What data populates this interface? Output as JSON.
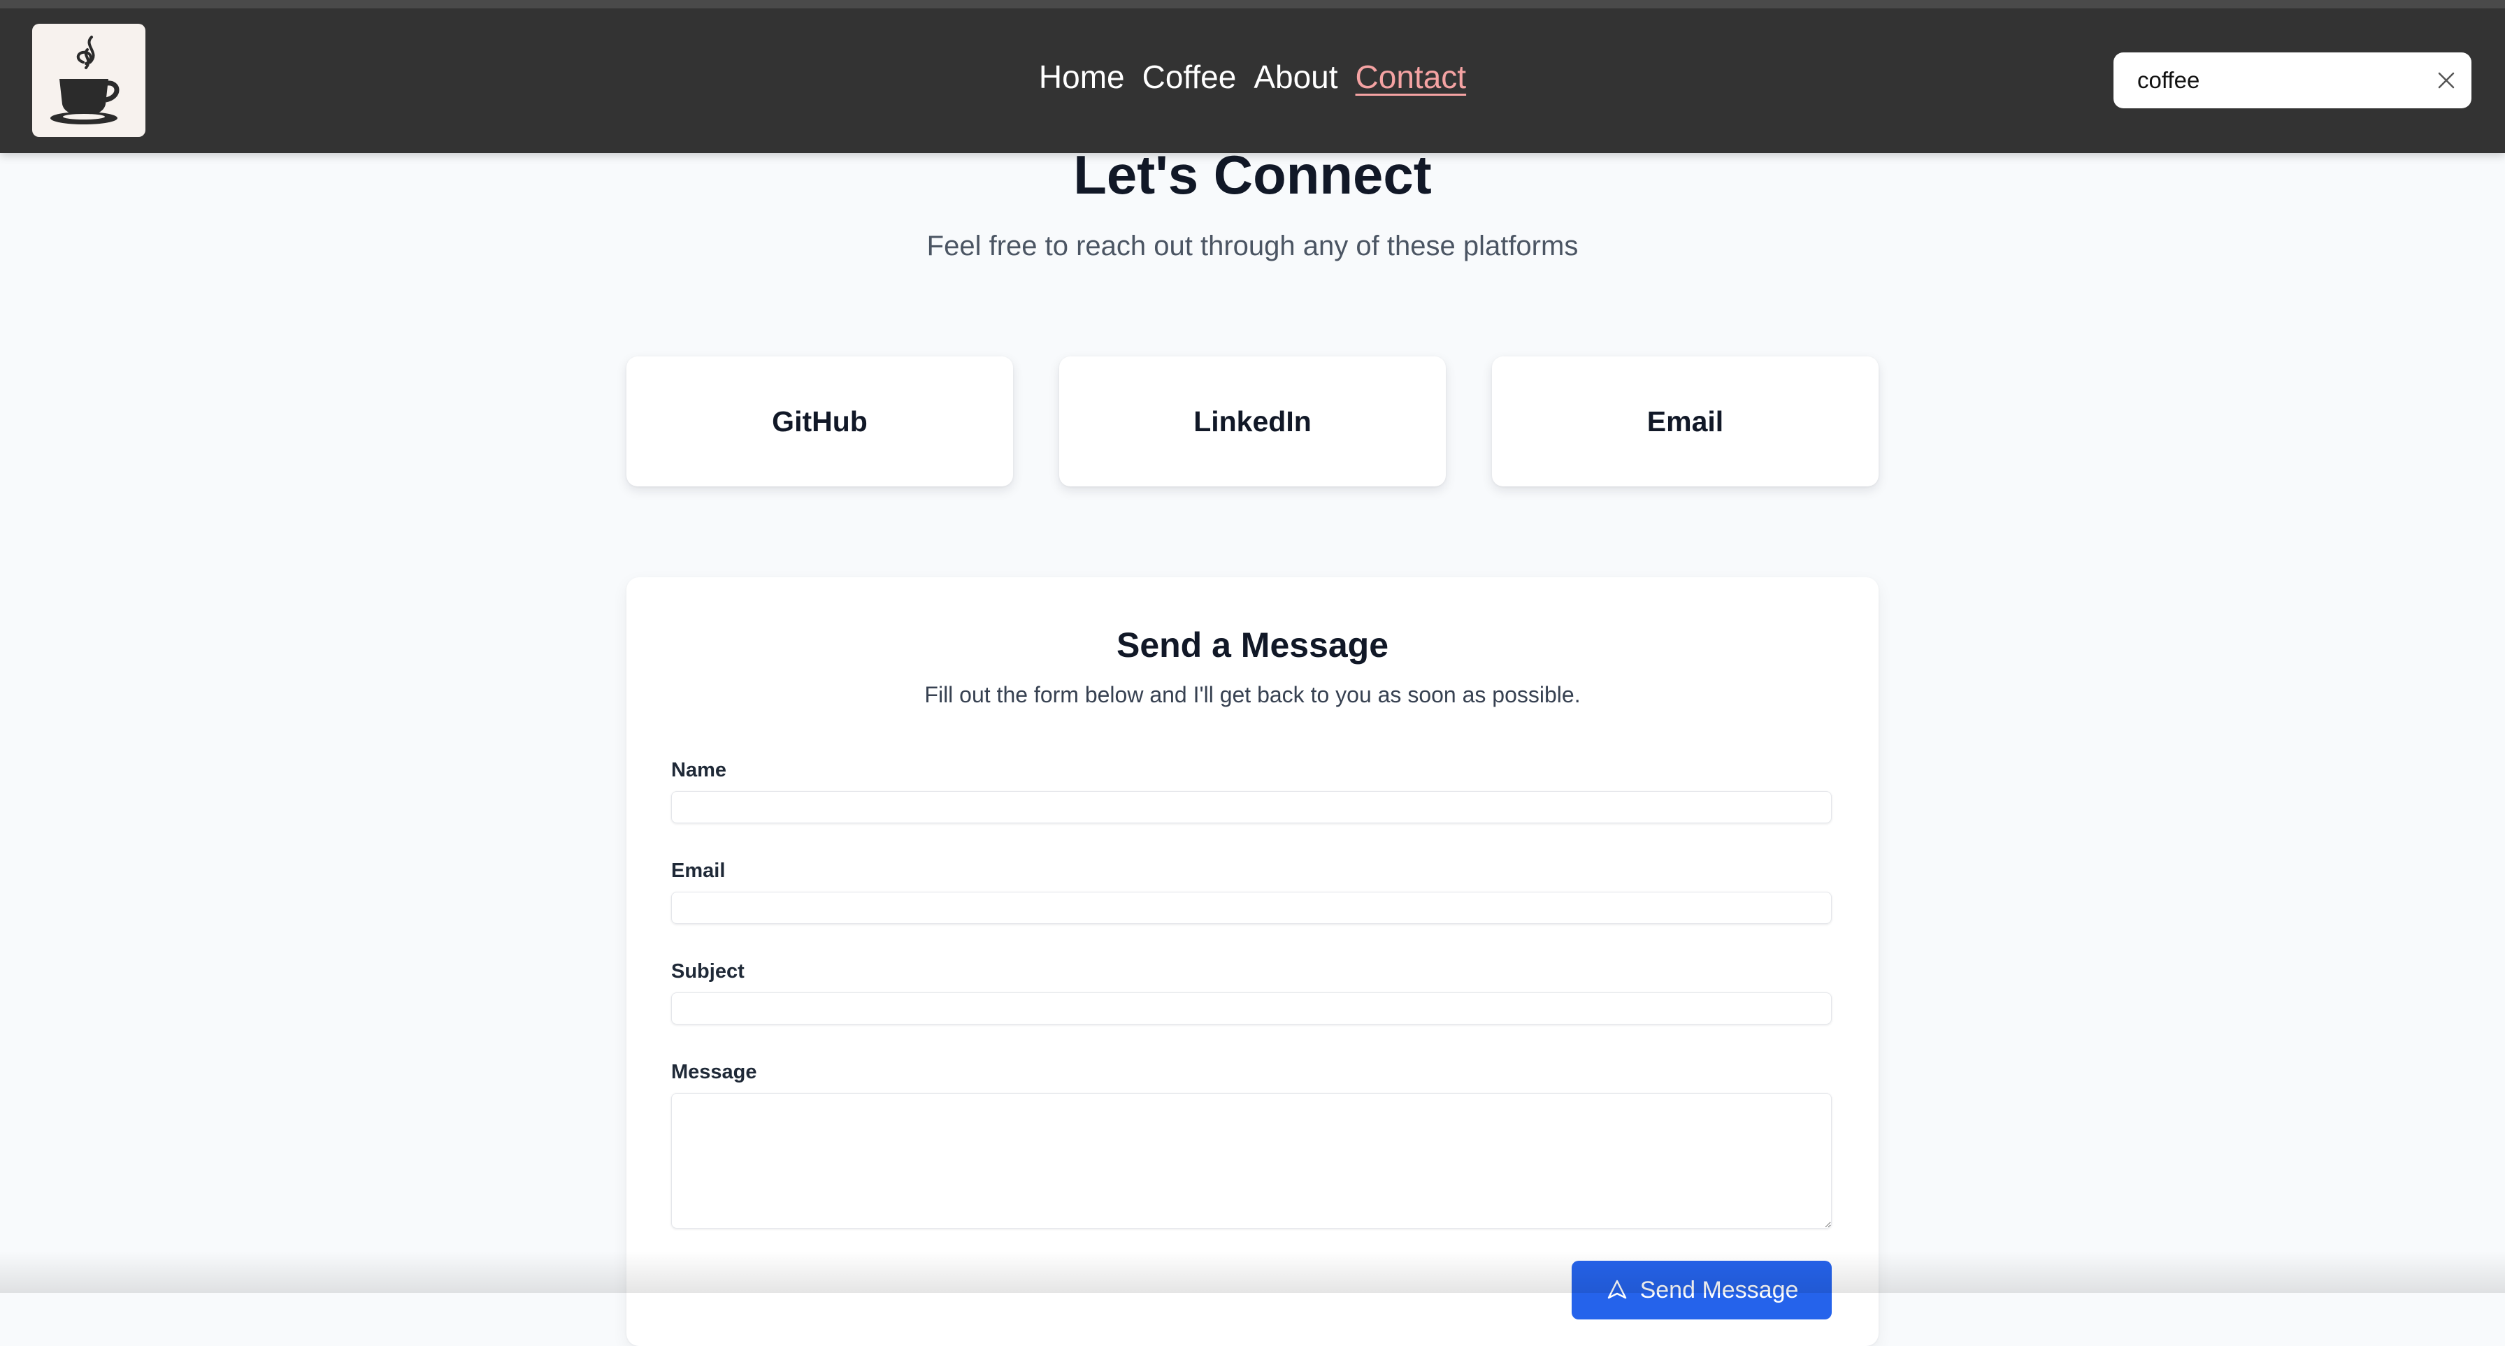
{
  "nav": {
    "links": [
      {
        "label": "Home"
      },
      {
        "label": "Coffee"
      },
      {
        "label": "About"
      },
      {
        "label": "Contact",
        "active": true
      }
    ],
    "active_color": "#f5a3a3",
    "background": "#333333"
  },
  "search": {
    "value": "coffee",
    "clear_icon": "close-icon"
  },
  "logo": {
    "icon": "coffee-cup-icon"
  },
  "hero": {
    "title": "Let's Connect",
    "subtitle": "Feel free to reach out through any of these platforms"
  },
  "platforms": [
    {
      "label": "GitHub"
    },
    {
      "label": "LinkedIn"
    },
    {
      "label": "Email"
    }
  ],
  "form": {
    "title": "Send a Message",
    "description": "Fill out the form below and I'll get back to you as soon as possible.",
    "fields": {
      "name": {
        "label": "Name",
        "value": ""
      },
      "email": {
        "label": "Email",
        "value": ""
      },
      "subject": {
        "label": "Subject",
        "value": ""
      },
      "message": {
        "label": "Message",
        "value": ""
      }
    },
    "submit_label": "Send Message",
    "submit_icon": "send-icon",
    "accent": "#2563eb"
  }
}
